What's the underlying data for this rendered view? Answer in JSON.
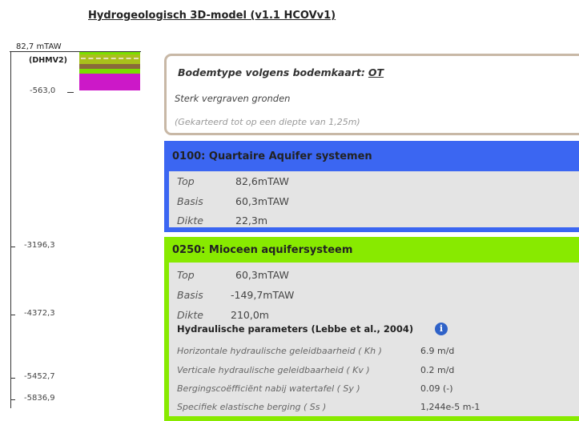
{
  "title": "Hydrogeologisch 3D-model (v1.1 HCOVv1)",
  "profile": {
    "top_value": "82,7 mTAW",
    "reference_label": "(DHMV2)",
    "depth_labels": [
      "-563,0",
      "-3196,3",
      "-4372,3",
      "-5452,7",
      "-5836,9"
    ],
    "layer_colors": {
      "top": "#7be000",
      "main": "#a9c01b",
      "brown": "#8a6a3a",
      "green": "#7bdc00",
      "magenta": "#cc18c8"
    }
  },
  "soil": {
    "title_prefix": "Bodemtype volgens bodemkaart:",
    "code": "OT",
    "description": "Sterk vergraven gronden",
    "note": "(Gekarteerd tot op een diepte van 1,25m)",
    "border_color": "#c8b8a6"
  },
  "layers": [
    {
      "title": "0100: Quartaire Aquifer systemen",
      "color": "#3b66f2",
      "props": [
        {
          "key": "Top",
          "value": "82,6mTAW"
        },
        {
          "key": "Basis",
          "value": "60,3mTAW"
        },
        {
          "key": "Dikte",
          "value": "22,3m"
        }
      ]
    },
    {
      "title": "0250: Mioceen aquifersysteem",
      "color": "#88ea00",
      "props": [
        {
          "key": "Top",
          "value": "60,3mTAW"
        },
        {
          "key": "Basis",
          "value": "-149,7mTAW"
        },
        {
          "key": "Dikte",
          "value": "210,0m"
        }
      ],
      "hydraulic_title": "Hydraulische parameters (Lebbe et al., 2004)",
      "info_icon": "info-icon",
      "params": [
        {
          "name": "Horizontale hydraulische geleidbaarheid ( Kh )",
          "value": "6.9 m/d"
        },
        {
          "name": "Verticale hydraulische geleidbaarheid ( Kv )",
          "value": "0.2 m/d"
        },
        {
          "name": "Bergingscoëfficiënt nabij watertafel ( Sy )",
          "value": "0.09 (-)"
        },
        {
          "name": "Specifiek elastische berging ( Ss )",
          "value": "1,244e-5 m-1"
        }
      ]
    }
  ]
}
